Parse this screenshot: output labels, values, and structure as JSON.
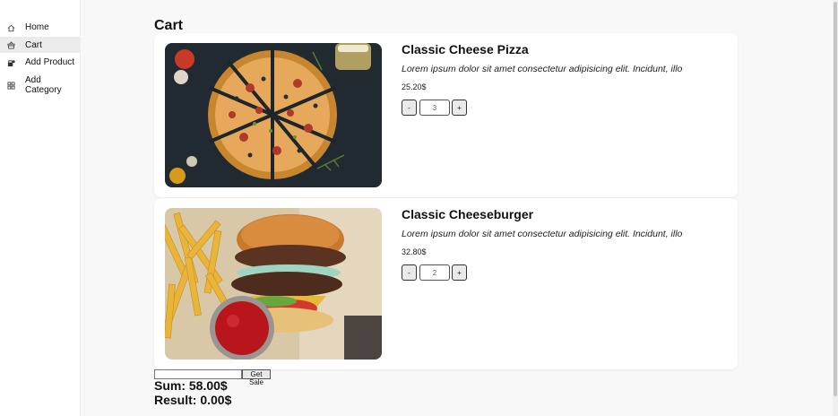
{
  "sidebar": {
    "items": [
      {
        "label": "Home",
        "icon": "home-icon"
      },
      {
        "label": "Cart",
        "icon": "basket-icon"
      },
      {
        "label": "Add Product",
        "icon": "add-product-icon"
      },
      {
        "label": "Add\nCategory",
        "icon": "grid-icon"
      }
    ],
    "active": "Cart"
  },
  "main": {
    "title": "Cart",
    "items": [
      {
        "name": "Classic Cheese Pizza",
        "description": "Lorem ipsum dolor sit amet consectetur adipisicing elit. Incidunt, illo",
        "price": "25.20$",
        "quantity": "3",
        "decrement_label": "-",
        "increment_label": "+",
        "image": "pizza-photo"
      },
      {
        "name": "Classic Cheeseburger",
        "description": "Lorem ipsum dolor sit amet consectetur adipisicing elit. Incidunt, illo",
        "price": "32.80$",
        "quantity": "2",
        "decrement_label": "-",
        "increment_label": "+",
        "image": "burger-photo"
      }
    ],
    "sale": {
      "input_value": "",
      "button_label": "Get Sale"
    },
    "sum": "Sum: 58.00$",
    "result": "Result: 0.00$"
  },
  "colors": {
    "background": "#f8f8f8",
    "card": "#ffffff",
    "active_nav": "#ebebeb"
  }
}
